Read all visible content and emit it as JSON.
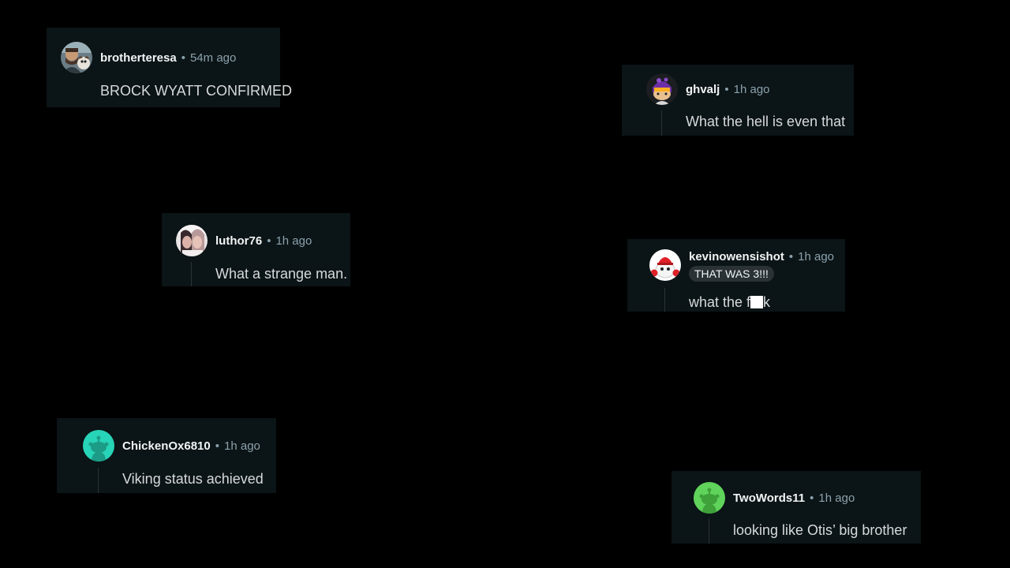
{
  "comments": [
    {
      "username": "brotherteresa",
      "separator": "•",
      "time": "54m ago",
      "body": "BROCK WYATT CONFIRMED",
      "avatar_icon": "photo-avatar-man-with-dog-icon"
    },
    {
      "username": "ghvalj",
      "separator": "•",
      "time": "1h ago",
      "body": "What the hell is even that",
      "avatar_icon": "purple-masked-avatar-icon"
    },
    {
      "username": "luthor76",
      "separator": "•",
      "time": "1h ago",
      "body": "What a strange man.",
      "avatar_icon": "photo-avatar-couple-icon"
    },
    {
      "username": "kevinowensishot",
      "separator": "•",
      "time": "1h ago",
      "flair": "THAT WAS 3!!!",
      "body_prefix": "what the f",
      "body_suffix": "k",
      "avatar_icon": "red-snoo-avatar-icon"
    },
    {
      "username": "ChickenOx6810",
      "separator": "•",
      "time": "1h ago",
      "body": "Viking status achieved",
      "avatar_icon": "default-snoo-avatar-icon",
      "avatar_color": "#27d4b8"
    },
    {
      "username": "TwoWords11",
      "separator": "•",
      "time": "1h ago",
      "body": "looking like Otis’ big brother",
      "avatar_icon": "default-snoo-avatar-icon",
      "avatar_color": "#5fd35a"
    }
  ],
  "colors": {
    "background": "#000000",
    "card": "#0b1416",
    "username": "#f2f4f5",
    "meta": "#8ba2ad",
    "body": "#d7dadc",
    "flair_bg": "#2a3236",
    "thread_line": "#2a3236"
  }
}
